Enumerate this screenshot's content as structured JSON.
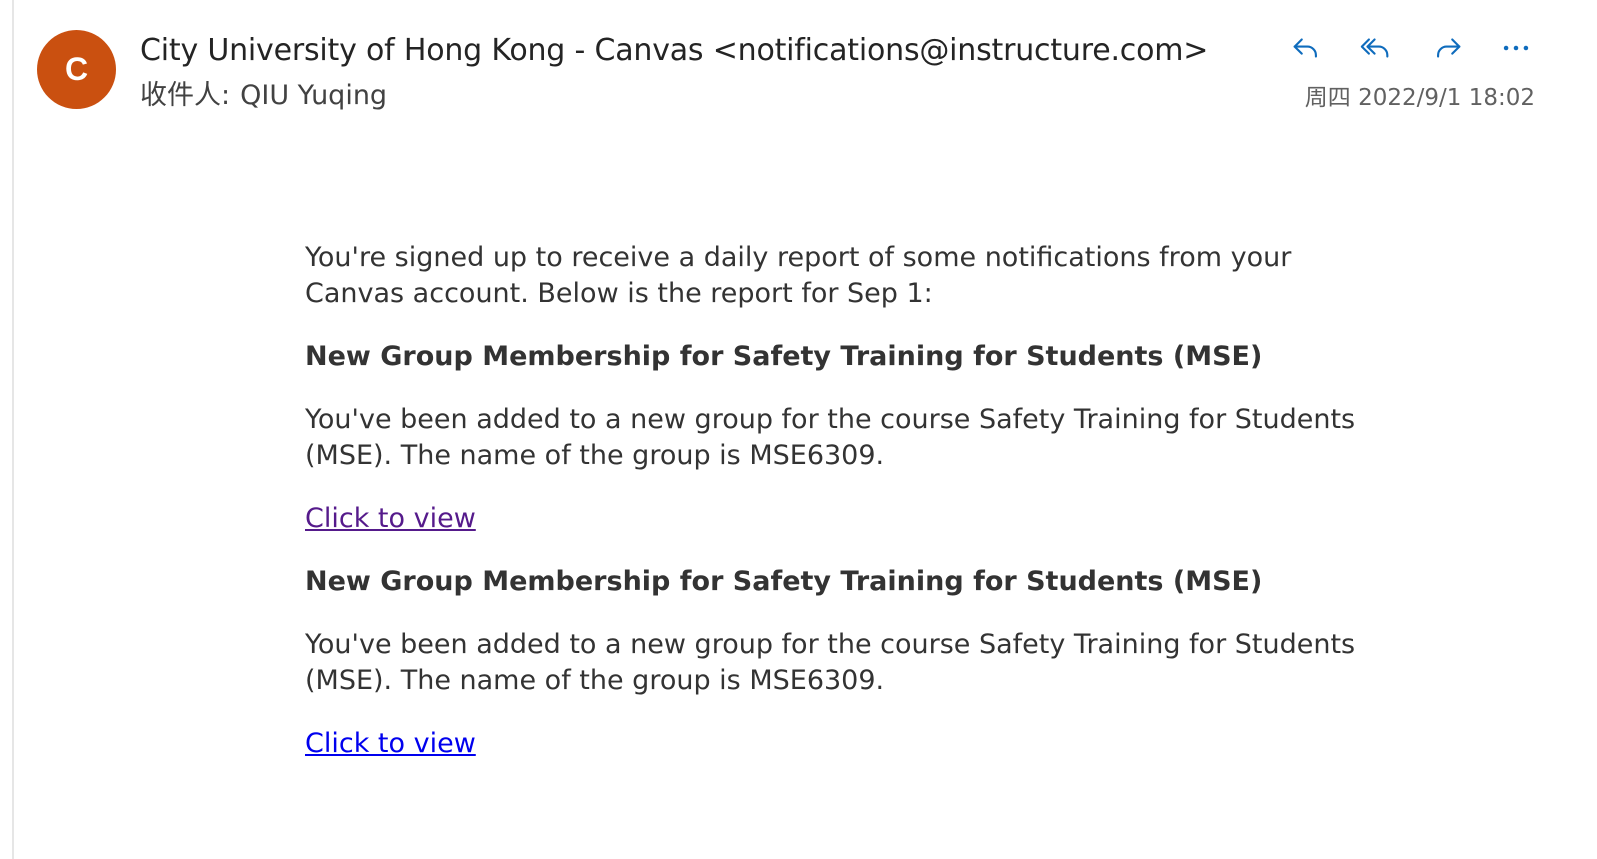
{
  "header": {
    "avatar_letter": "C",
    "avatar_color": "#ca5010",
    "sender": "City University of Hong Kong - Canvas <notifications@instructure.com>",
    "recipient_label": "收件人:",
    "recipient_name": "QIU Yuqing",
    "timestamp": "周四 2022/9/1 18:02",
    "actions": [
      {
        "name": "reply",
        "icon": "reply-icon"
      },
      {
        "name": "reply-all",
        "icon": "reply-all-icon"
      },
      {
        "name": "forward",
        "icon": "forward-icon"
      },
      {
        "name": "more",
        "icon": "more-icon"
      }
    ],
    "accent_color": "#0f6cbd"
  },
  "body": {
    "intro": "You're signed up to receive a daily report of some notifications from your Canvas account. Below is the report for Sep 1:",
    "items": [
      {
        "heading": "New Group Membership for Safety Training for Students (MSE)",
        "text": "You've been added to a new group for the course Safety Training for Students (MSE). The name of the group is MSE6309.",
        "link": "Click to view",
        "link_color": "#551a8b"
      },
      {
        "heading": "New Group Membership for Safety Training for Students (MSE)",
        "text": "You've been added to a new group for the course Safety Training for Students (MSE). The name of the group is MSE6309.",
        "link": "Click to view",
        "link_color": "#0000ee"
      }
    ]
  }
}
